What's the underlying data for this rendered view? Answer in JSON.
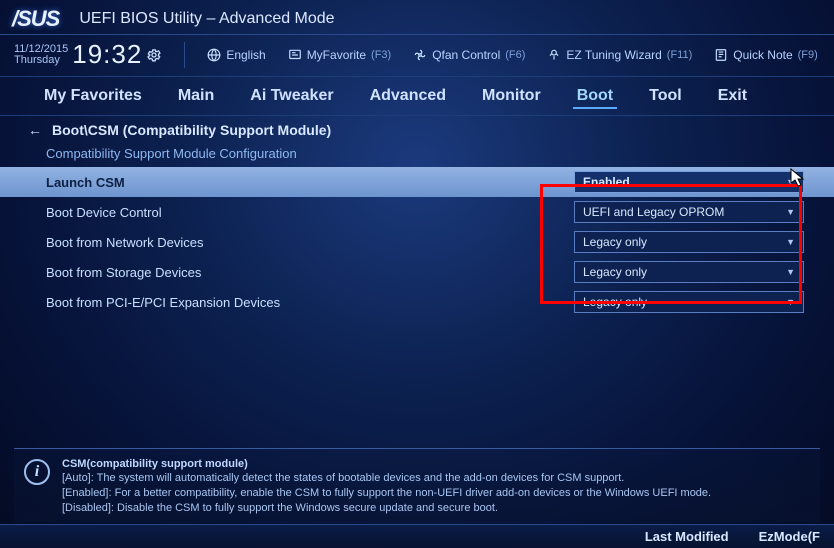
{
  "header": {
    "brand": "/SUS",
    "title": "UEFI BIOS Utility – Advanced Mode"
  },
  "status": {
    "date": "11/12/2015",
    "day": "Thursday",
    "time": "19:32",
    "items": [
      {
        "label": "English",
        "hotkey": ""
      },
      {
        "label": "MyFavorite",
        "hotkey": "(F3)"
      },
      {
        "label": "Qfan Control",
        "hotkey": "(F6)"
      },
      {
        "label": "EZ Tuning Wizard",
        "hotkey": "(F11)"
      },
      {
        "label": "Quick Note",
        "hotkey": "(F9)"
      }
    ]
  },
  "tabs": [
    "My Favorites",
    "Main",
    "Ai Tweaker",
    "Advanced",
    "Monitor",
    "Boot",
    "Tool",
    "Exit"
  ],
  "active_tab": "Boot",
  "breadcrumb": "Boot\\CSM (Compatibility Support Module)",
  "section_title": "Compatibility Support Module Configuration",
  "settings": [
    {
      "label": "Launch CSM",
      "value": "Enabled",
      "selected": true
    },
    {
      "label": "Boot Device Control",
      "value": "UEFI and Legacy OPROM",
      "selected": false
    },
    {
      "label": "Boot from Network Devices",
      "value": "Legacy only",
      "selected": false
    },
    {
      "label": "Boot from Storage Devices",
      "value": "Legacy only",
      "selected": false
    },
    {
      "label": "Boot from PCI-E/PCI Expansion Devices",
      "value": "Legacy only",
      "selected": false
    }
  ],
  "help": {
    "title": "CSM(compatibility support module)",
    "lines": [
      "[Auto]: The system will automatically detect the states of bootable devices and the add-on devices for CSM support.",
      "[Enabled]: For a better compatibility, enable the CSM to fully support the non-UEFI driver add-on devices or the Windows UEFI mode.",
      "[Disabled]: Disable the CSM to fully support the Windows secure update and secure boot."
    ]
  },
  "footer": {
    "last_modified": "Last Modified",
    "ezmode": "EzMode(F"
  }
}
